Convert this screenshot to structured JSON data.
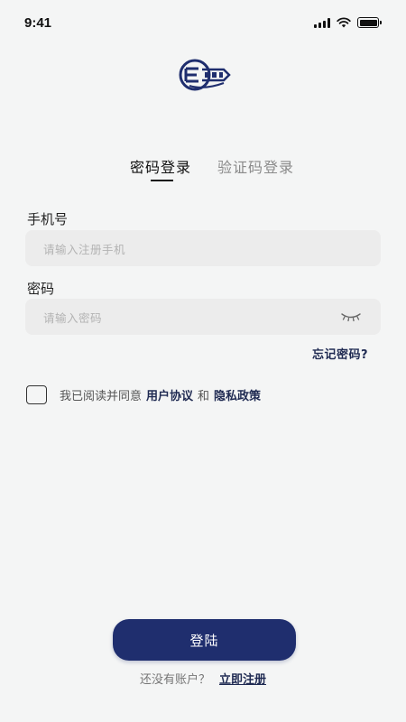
{
  "status_bar": {
    "time": "9:41",
    "battery_level": 1.0
  },
  "brand": {
    "logo_text": "EPG",
    "logo_color": "#1f2e6e"
  },
  "tabs": [
    {
      "label": "密码登录",
      "active": true
    },
    {
      "label": "验证码登录",
      "active": false
    }
  ],
  "form": {
    "phone": {
      "label": "手机号",
      "placeholder": "请输入注册手机",
      "value": ""
    },
    "password": {
      "label": "密码",
      "placeholder": "请输入密码",
      "value": "",
      "visibility_icon": "eye-closed-icon"
    },
    "forgot_password": "忘记密码?"
  },
  "agreement": {
    "checked": false,
    "prefix": "我已阅读并同意",
    "user_agreement": "用户协议",
    "conjunction": "和",
    "privacy_policy": "隐私政策"
  },
  "actions": {
    "login_label": "登陆",
    "no_account_text": "还没有账户？",
    "register_label": "立即注册"
  },
  "colors": {
    "background": "#f4f5f5",
    "primary": "#1f2e6e",
    "link": "#1f2a52",
    "input_bg": "#ececec",
    "placeholder": "#b3b3b3"
  }
}
